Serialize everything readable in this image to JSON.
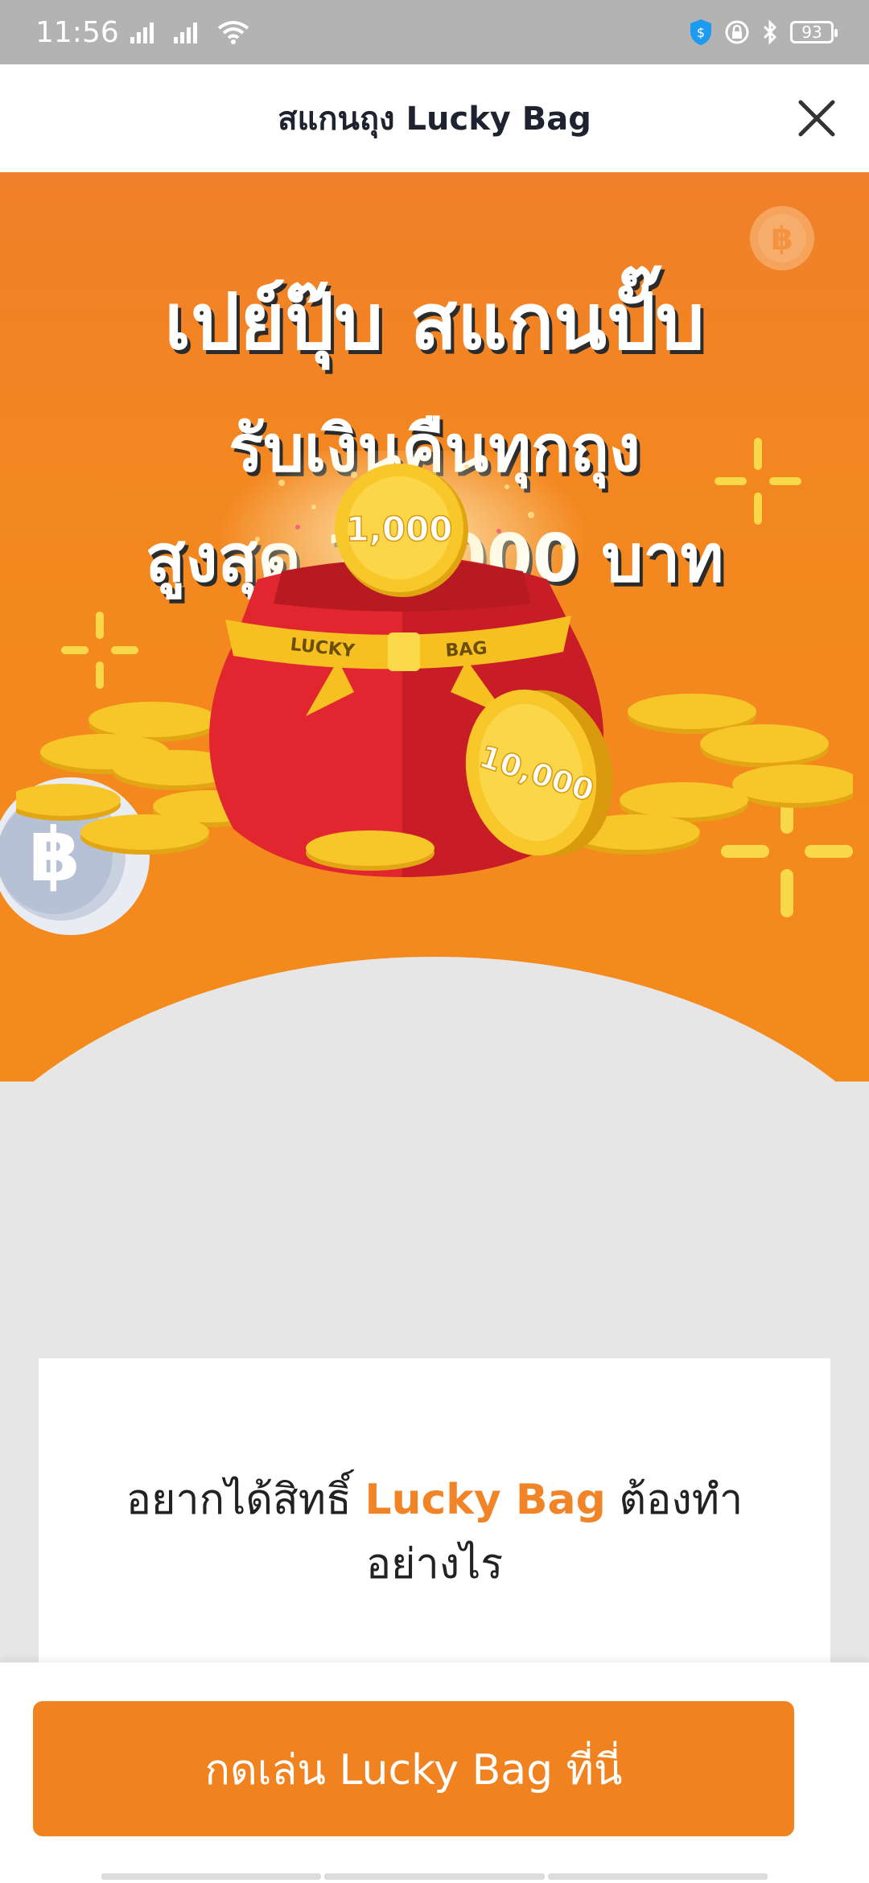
{
  "status_bar": {
    "time": "11:56",
    "battery": "93"
  },
  "header": {
    "title": "สแกนถุง Lucky Bag",
    "close_icon": "close-icon"
  },
  "hero": {
    "headline_1": "เปย์ปุ๊บ สแกนปั๊บ",
    "headline_2": "รับเงินคืนทุกถุง",
    "headline_3": "สูงสุด 10,000 บาท",
    "coin_top_label": "1,000",
    "coin_front_label": "10,000",
    "bag_band_left": "LUCKY",
    "bag_band_right": "BAG",
    "baht_symbol": "฿"
  },
  "info_card": {
    "title_prefix": "อยากได้สิทธิ์ ",
    "title_accent": "Lucky Bag",
    "title_suffix": " ต้องทำอย่างไร"
  },
  "cta": {
    "label": "กดเล่น Lucky Bag ที่นี่"
  },
  "colors": {
    "brand_orange": "#f0821f",
    "accent_text": "#f08426",
    "coin_gold": "#f6c21c",
    "bag_red": "#d8222c"
  }
}
